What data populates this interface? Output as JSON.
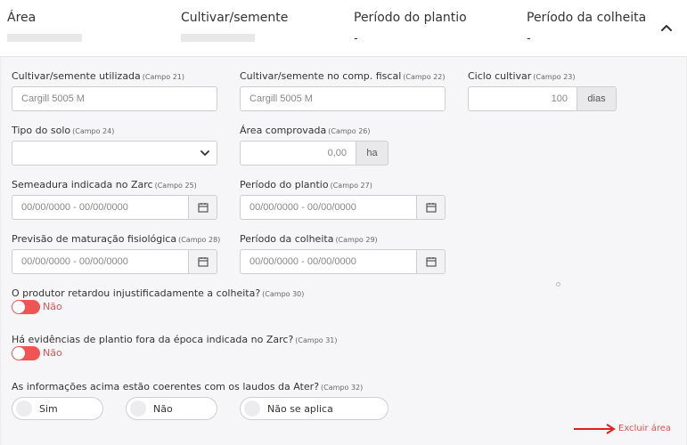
{
  "header": {
    "col1_title": "Área",
    "col2_title": "Cultivar/semente",
    "col3_title": "Período do plantio",
    "col3_value": "-",
    "col4_title": "Período da colheita",
    "col4_value": "-"
  },
  "fields": {
    "cultivar_utilizada": {
      "label": "Cultivar/semente utilizada",
      "campo": "(Campo 21)",
      "placeholder": "Cargill 5005 M"
    },
    "cultivar_fiscal": {
      "label": "Cultivar/semente no comp. fiscal",
      "campo": "(Campo 22)",
      "placeholder": "Cargill 5005 M"
    },
    "ciclo": {
      "label": "Ciclo cultivar",
      "campo": "(Campo 23)",
      "value": "100",
      "unit": "dias"
    },
    "tipo_solo": {
      "label": "Tipo do solo",
      "campo": "(Campo 24)",
      "value": ""
    },
    "area_comprovada": {
      "label": "Área comprovada",
      "campo": "(Campo 26)",
      "placeholder": "0,00",
      "unit": "ha"
    },
    "semeadura": {
      "label": "Semeadura indicada no Zarc",
      "campo": "(Campo 25)",
      "placeholder": "00/00/0000 - 00/00/0000"
    },
    "periodo_plantio": {
      "label": "Período do plantio",
      "campo": "(Campo 27)",
      "placeholder": "00/00/0000 - 00/00/0000"
    },
    "maturacao": {
      "label": "Previsão de maturação fisiológica",
      "campo": "(Campo 28)",
      "placeholder": "00/00/0000 - 00/00/0000"
    },
    "periodo_colheita": {
      "label": "Período da colheita",
      "campo": "(Campo 29)",
      "placeholder": "00/00/0000 - 00/00/0000"
    }
  },
  "toggles": {
    "retardou": {
      "label": "O produtor retardou injustificadamente a colheita?",
      "campo": "(Campo 30)",
      "state": "Não"
    },
    "evidencias": {
      "label": "Há evidências de plantio fora da época indicada no Zarc?",
      "campo": "(Campo 31)",
      "state": "Não"
    }
  },
  "coerentes": {
    "label": "As informações acima estão coerentes com os laudos da Ater?",
    "campo": "(Campo 32)",
    "options": [
      "Sim",
      "Não",
      "Não se aplica"
    ]
  },
  "actions": {
    "excluir": "Excluir área"
  },
  "colors": {
    "accent_red": "#ee5554",
    "panel_bg": "#f6f6f8"
  },
  "icons": [
    "chevron-up-icon",
    "chevron-down-icon",
    "calendar-icon",
    "arrow-right-icon"
  ]
}
